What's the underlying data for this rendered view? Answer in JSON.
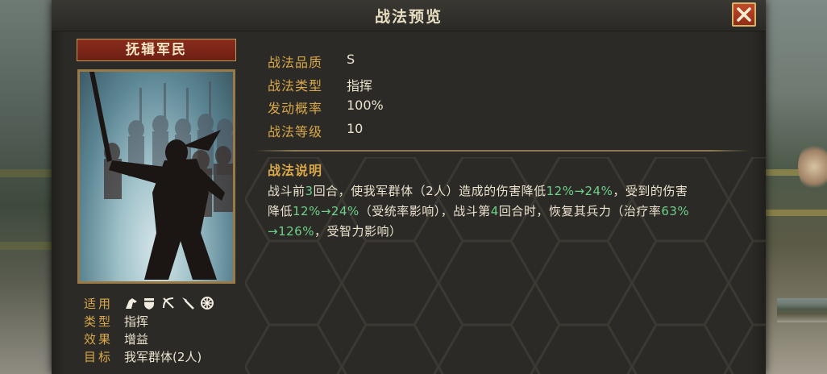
{
  "modal": {
    "title": "战法预览"
  },
  "skill": {
    "name": "抚辑军民",
    "attributes": [
      {
        "label": "战法品质",
        "value": "S"
      },
      {
        "label": "战法类型",
        "value": "指挥"
      },
      {
        "label": "发动概率",
        "value": "100%"
      },
      {
        "label": "战法等级",
        "value": "10"
      }
    ],
    "description_title": "战法说明",
    "description": {
      "l1": [
        "战斗前",
        "3",
        "回合，使我军群体（2人）造成的伤害降低",
        "12%→24%",
        "，受到的伤害"
      ],
      "l2": [
        "降低",
        "12%→24%",
        "（受统率影响），战斗第",
        "4",
        "回合时，恢复其兵力（治疗率",
        "63%"
      ],
      "l3": [
        "→126%",
        "，受智力影响）"
      ]
    },
    "info": [
      {
        "label": "适用",
        "value": ""
      },
      {
        "label": "类型",
        "value": "指挥"
      },
      {
        "label": "效果",
        "value": "增益"
      },
      {
        "label": "目标",
        "value": "我军群体(2人)"
      }
    ],
    "applicable_units": [
      "cavalry-icon",
      "shield-icon",
      "bow-icon",
      "spear-icon",
      "siege-icon"
    ]
  },
  "colors": {
    "label_gold": "#d8a84a",
    "value_text": "#ece3cf",
    "highlight_green": "#6ed08a",
    "close_red": "#c24a2a"
  }
}
